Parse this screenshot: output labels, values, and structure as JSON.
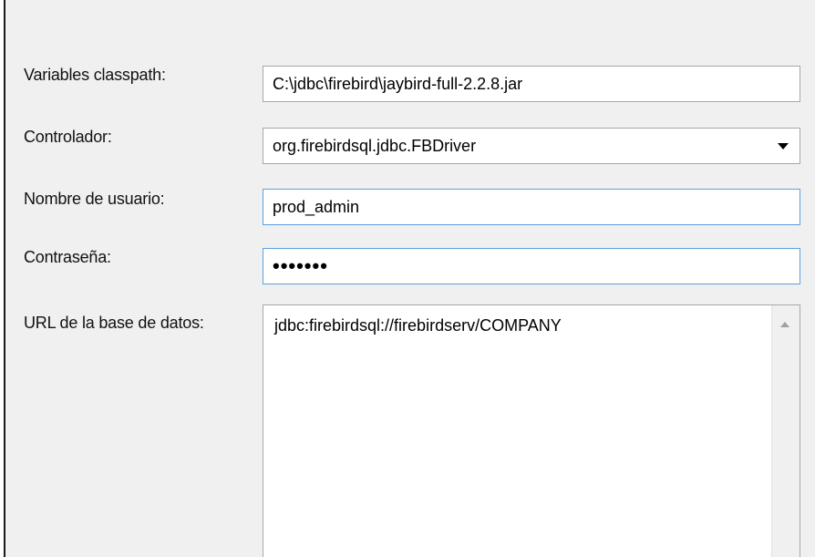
{
  "form": {
    "classpath": {
      "label": "Variables classpath:",
      "value": "C:\\jdbc\\firebird\\jaybird-full-2.2.8.jar"
    },
    "driver": {
      "label": "Controlador:",
      "value": "org.firebirdsql.jdbc.FBDriver"
    },
    "username": {
      "label": "Nombre de usuario:",
      "value": "prod_admin"
    },
    "password": {
      "label": "Contraseña:",
      "value": "•••••••"
    },
    "db_url": {
      "label": "URL de la base de datos:",
      "value": "jdbc:firebirdsql://firebirdserv/COMPANY"
    }
  },
  "icons": {
    "dropdown": "chevron-down-icon",
    "scroll_up": "scroll-up-arrow-icon"
  }
}
